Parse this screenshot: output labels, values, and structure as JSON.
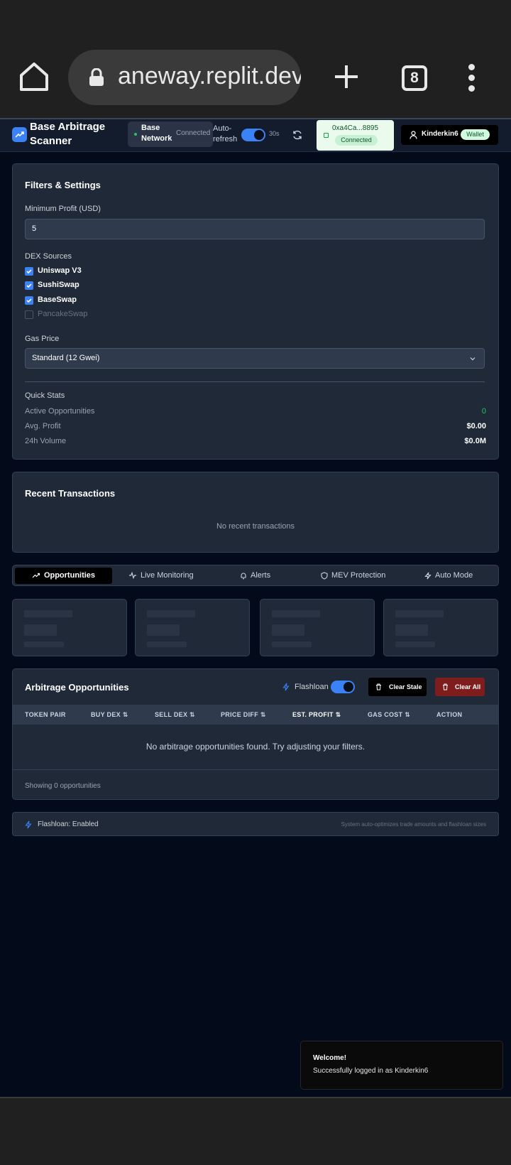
{
  "browser": {
    "url": "aneway.replit.dev",
    "tab_count": "8"
  },
  "header": {
    "brand": "Base Arbitrage Scanner",
    "network_name": "Base Network",
    "network_status": "Connected",
    "auto_refresh_label": "Auto-refresh",
    "auto_refresh_on": true,
    "refresh_interval": "30s",
    "wallet_address": "0xa4Ca...8895",
    "wallet_status": "Connected",
    "username": "Kinderkin6",
    "wallet_badge": "Wallet"
  },
  "filters": {
    "title": "Filters & Settings",
    "min_profit_label": "Minimum Profit (USD)",
    "min_profit_value": "5",
    "dex_label": "DEX Sources",
    "dexes": [
      {
        "label": "Uniswap V3",
        "checked": true
      },
      {
        "label": "SushiSwap",
        "checked": true
      },
      {
        "label": "BaseSwap",
        "checked": true
      },
      {
        "label": "PancakeSwap",
        "checked": false
      }
    ],
    "gas_label": "Gas Price",
    "gas_value": "Standard (12 Gwei)",
    "quick_stats_title": "Quick Stats",
    "stats": [
      {
        "label": "Active Opportunities",
        "value": "0"
      },
      {
        "label": "Avg. Profit",
        "value": "$0.00"
      },
      {
        "label": "24h Volume",
        "value": "$0.0M"
      }
    ]
  },
  "recent": {
    "title": "Recent Transactions",
    "empty": "No recent transactions"
  },
  "tabs": [
    "Opportunities",
    "Live Monitoring",
    "Alerts",
    "MEV Protection",
    "Auto Mode"
  ],
  "opportunities": {
    "title": "Arbitrage Opportunities",
    "flashloan_label": "Flashloan",
    "flashloan_on": true,
    "clear_stale": "Clear Stale",
    "clear_all": "Clear All",
    "columns": [
      "TOKEN PAIR",
      "BUY DEX",
      "SELL DEX",
      "PRICE DIFF",
      "EST. PROFIT",
      "GAS COST",
      "ACTION"
    ],
    "empty": "No arbitrage opportunities found. Try adjusting your filters.",
    "showing": "Showing 0 opportunities"
  },
  "footer": {
    "flashloan_status": "Flashloan: Enabled",
    "note": "System auto-optimizes trade amounts and flashloan sizes"
  },
  "toast": {
    "title": "Welcome!",
    "message": "Successfully logged in as Kinderkin6"
  },
  "colors": {
    "accent": "#3b82f6",
    "success": "#22c55e",
    "danger": "#7f1d1d",
    "background": "#030a1a",
    "card": "#1f2937"
  }
}
